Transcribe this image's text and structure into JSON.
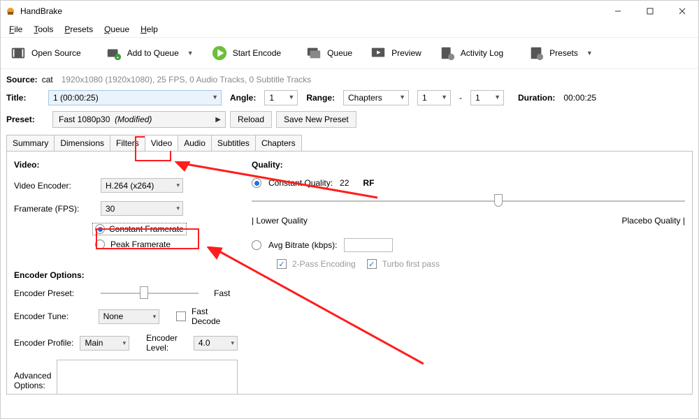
{
  "app": {
    "title": "HandBrake"
  },
  "menubar": {
    "file": "File",
    "tools": "Tools",
    "presets": "Presets",
    "queue": "Queue",
    "help": "Help"
  },
  "toolbar": {
    "open_source": "Open Source",
    "add_to_queue": "Add to Queue",
    "start_encode": "Start Encode",
    "queue": "Queue",
    "preview": "Preview",
    "activity_log": "Activity Log",
    "presets": "Presets"
  },
  "source": {
    "label": "Source:",
    "name": "cat",
    "info": "1920x1080 (1920x1080), 25 FPS, 0 Audio Tracks, 0 Subtitle Tracks"
  },
  "titlebar_row": {
    "title_label": "Title:",
    "title_value": "1  (00:00:25)",
    "angle_label": "Angle:",
    "angle_value": "1",
    "range_label": "Range:",
    "range_type": "Chapters",
    "range_from": "1",
    "range_sep": "-",
    "range_to": "1",
    "duration_label": "Duration:",
    "duration_value": "00:00:25"
  },
  "presetbar": {
    "label": "Preset:",
    "name": "Fast 1080p30",
    "modified": "(Modified)",
    "reload": "Reload",
    "save_new": "Save New Preset"
  },
  "tabs": {
    "summary": "Summary",
    "dimensions": "Dimensions",
    "filters": "Filters",
    "video": "Video",
    "audio": "Audio",
    "subtitles": "Subtitles",
    "chapters": "Chapters"
  },
  "video": {
    "heading": "Video:",
    "encoder_label": "Video Encoder:",
    "encoder_value": "H.264 (x264)",
    "fps_label": "Framerate (FPS):",
    "fps_value": "30",
    "cfr": "Constant Framerate",
    "pfr": "Peak Framerate",
    "enc_heading": "Encoder Options:",
    "enc_preset_label": "Encoder Preset:",
    "enc_preset_value": "Fast",
    "enc_tune_label": "Encoder Tune:",
    "enc_tune_value": "None",
    "fast_decode": "Fast Decode",
    "enc_profile_label": "Encoder Profile:",
    "enc_profile_value": "Main",
    "enc_level_label": "Encoder Level:",
    "enc_level_value": "4.0",
    "adv_label": "Advanced Options:"
  },
  "quality": {
    "heading": "Quality:",
    "cq_label": "Constant Quality:",
    "cq_value": "22",
    "rf": "RF",
    "low": "| Lower Quality",
    "high": "Placebo Quality |",
    "avg_label": "Avg Bitrate (kbps):",
    "two_pass": "2-Pass Encoding",
    "turbo": "Turbo first pass"
  }
}
